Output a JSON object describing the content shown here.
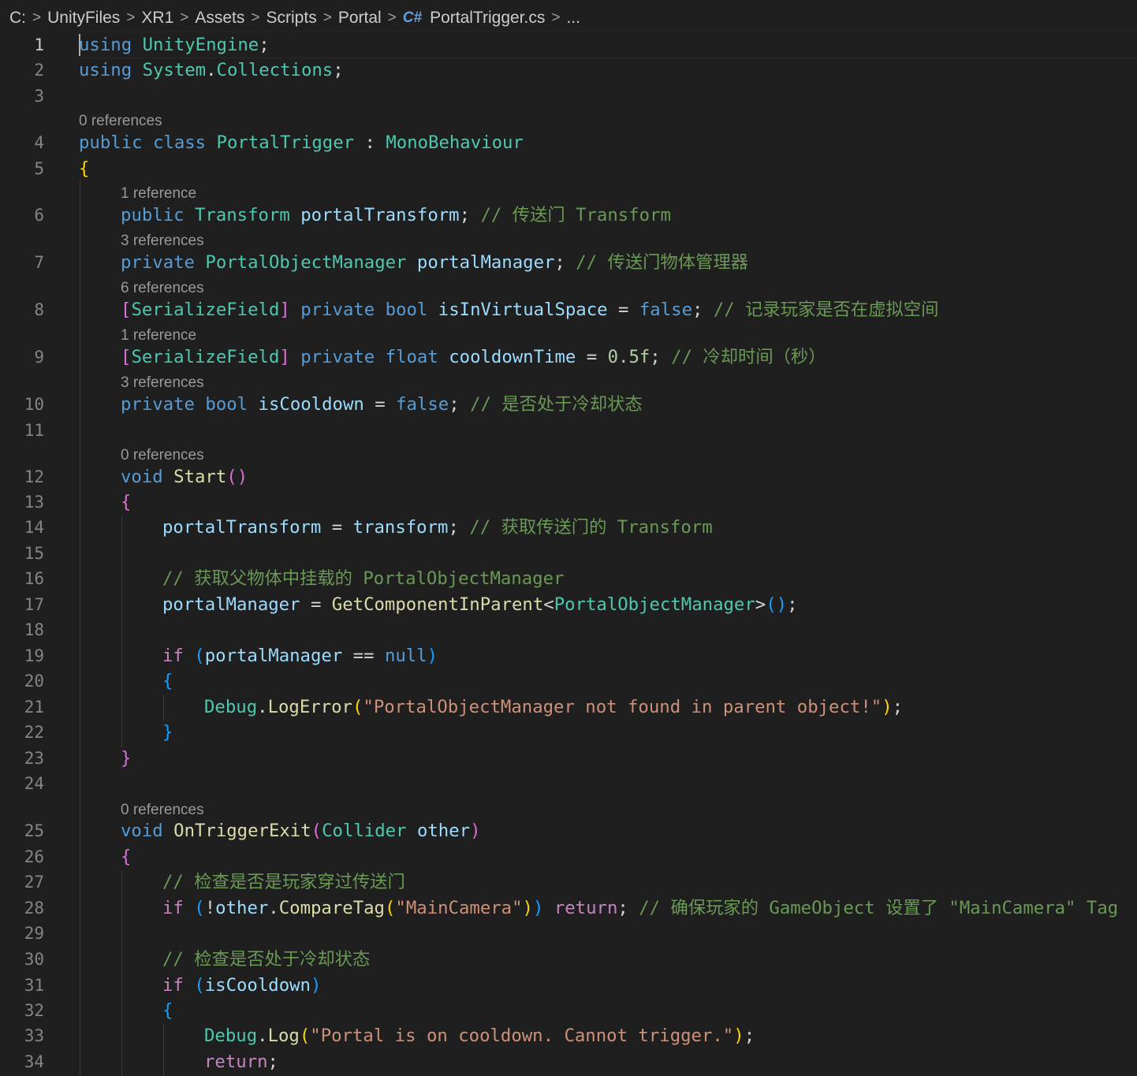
{
  "breadcrumb": [
    "C:",
    "UnityFiles",
    "XR1",
    "Assets",
    "Scripts",
    "Portal",
    "PortalTrigger.cs",
    "..."
  ],
  "cs_icon": "C#",
  "codelens": {
    "l4": "0 references",
    "l6": "1 reference",
    "l7": "3 references",
    "l8": "6 references",
    "l9": "1 reference",
    "l10": "3 references",
    "l12": "0 references",
    "l25": "0 references"
  },
  "lines": [
    {
      "n": "1",
      "tokens": [
        [
          "kw",
          "using"
        ],
        [
          "op",
          " "
        ],
        [
          "typ",
          "UnityEngine"
        ],
        [
          "op",
          ";"
        ]
      ]
    },
    {
      "n": "2",
      "tokens": [
        [
          "kw",
          "using"
        ],
        [
          "op",
          " "
        ],
        [
          "typ",
          "System"
        ],
        [
          "op",
          "."
        ],
        [
          "typ",
          "Collections"
        ],
        [
          "op",
          ";"
        ]
      ]
    },
    {
      "n": "3",
      "tokens": []
    },
    {
      "n": "4",
      "tokens": [
        [
          "kw",
          "public"
        ],
        [
          "op",
          " "
        ],
        [
          "kw",
          "class"
        ],
        [
          "op",
          " "
        ],
        [
          "typ",
          "PortalTrigger"
        ],
        [
          "op",
          " : "
        ],
        [
          "typ",
          "MonoBehaviour"
        ]
      ]
    },
    {
      "n": "5",
      "tokens": [
        [
          "p1",
          "{"
        ]
      ]
    },
    {
      "n": "6",
      "tokens": [
        [
          "kw",
          "public"
        ],
        [
          "op",
          " "
        ],
        [
          "typ",
          "Transform"
        ],
        [
          "op",
          " "
        ],
        [
          "var",
          "portalTransform"
        ],
        [
          "op",
          "; "
        ],
        [
          "cmt",
          "// 传送门 Transform"
        ]
      ]
    },
    {
      "n": "7",
      "tokens": [
        [
          "kw",
          "private"
        ],
        [
          "op",
          " "
        ],
        [
          "typ",
          "PortalObjectManager"
        ],
        [
          "op",
          " "
        ],
        [
          "var",
          "portalManager"
        ],
        [
          "op",
          "; "
        ],
        [
          "cmt",
          "// 传送门物体管理器"
        ]
      ]
    },
    {
      "n": "8",
      "tokens": [
        [
          "p2",
          "["
        ],
        [
          "typ",
          "SerializeField"
        ],
        [
          "p2",
          "]"
        ],
        [
          "op",
          " "
        ],
        [
          "kw",
          "private"
        ],
        [
          "op",
          " "
        ],
        [
          "kw",
          "bool"
        ],
        [
          "op",
          " "
        ],
        [
          "var",
          "isInVirtualSpace"
        ],
        [
          "op",
          " = "
        ],
        [
          "kw",
          "false"
        ],
        [
          "op",
          "; "
        ],
        [
          "cmt",
          "// 记录玩家是否在虚拟空间"
        ]
      ]
    },
    {
      "n": "9",
      "tokens": [
        [
          "p2",
          "["
        ],
        [
          "typ",
          "SerializeField"
        ],
        [
          "p2",
          "]"
        ],
        [
          "op",
          " "
        ],
        [
          "kw",
          "private"
        ],
        [
          "op",
          " "
        ],
        [
          "kw",
          "float"
        ],
        [
          "op",
          " "
        ],
        [
          "var",
          "cooldownTime"
        ],
        [
          "op",
          " = "
        ],
        [
          "num",
          "0.5f"
        ],
        [
          "op",
          "; "
        ],
        [
          "cmt",
          "// 冷却时间（秒）"
        ]
      ]
    },
    {
      "n": "10",
      "tokens": [
        [
          "kw",
          "private"
        ],
        [
          "op",
          " "
        ],
        [
          "kw",
          "bool"
        ],
        [
          "op",
          " "
        ],
        [
          "var",
          "isCooldown"
        ],
        [
          "op",
          " = "
        ],
        [
          "kw",
          "false"
        ],
        [
          "op",
          "; "
        ],
        [
          "cmt",
          "// 是否处于冷却状态"
        ]
      ]
    },
    {
      "n": "11",
      "tokens": []
    },
    {
      "n": "12",
      "tokens": [
        [
          "kw",
          "void"
        ],
        [
          "op",
          " "
        ],
        [
          "fn",
          "Start"
        ],
        [
          "p2",
          "()"
        ]
      ]
    },
    {
      "n": "13",
      "tokens": [
        [
          "p2",
          "{"
        ]
      ]
    },
    {
      "n": "14",
      "tokens": [
        [
          "var",
          "portalTransform"
        ],
        [
          "op",
          " = "
        ],
        [
          "var",
          "transform"
        ],
        [
          "op",
          "; "
        ],
        [
          "cmt",
          "// 获取传送门的 Transform"
        ]
      ]
    },
    {
      "n": "15",
      "tokens": []
    },
    {
      "n": "16",
      "tokens": [
        [
          "cmt",
          "// 获取父物体中挂载的 PortalObjectManager"
        ]
      ]
    },
    {
      "n": "17",
      "tokens": [
        [
          "var",
          "portalManager"
        ],
        [
          "op",
          " = "
        ],
        [
          "fn",
          "GetComponentInParent"
        ],
        [
          "op",
          "<"
        ],
        [
          "typ",
          "PortalObjectManager"
        ],
        [
          "op",
          ">"
        ],
        [
          "p3",
          "()"
        ],
        [
          "op",
          ";"
        ]
      ]
    },
    {
      "n": "18",
      "tokens": []
    },
    {
      "n": "19",
      "tokens": [
        [
          "ctl",
          "if"
        ],
        [
          "op",
          " "
        ],
        [
          "p3",
          "("
        ],
        [
          "var",
          "portalManager"
        ],
        [
          "op",
          " == "
        ],
        [
          "kw",
          "null"
        ],
        [
          "p3",
          ")"
        ]
      ]
    },
    {
      "n": "20",
      "tokens": [
        [
          "p3",
          "{"
        ]
      ]
    },
    {
      "n": "21",
      "tokens": [
        [
          "typ",
          "Debug"
        ],
        [
          "op",
          "."
        ],
        [
          "fn",
          "LogError"
        ],
        [
          "p1",
          "("
        ],
        [
          "str",
          "\"PortalObjectManager not found in parent object!\""
        ],
        [
          "p1",
          ")"
        ],
        [
          "op",
          ";"
        ]
      ]
    },
    {
      "n": "22",
      "tokens": [
        [
          "p3",
          "}"
        ]
      ]
    },
    {
      "n": "23",
      "tokens": [
        [
          "p2",
          "}"
        ]
      ]
    },
    {
      "n": "24",
      "tokens": []
    },
    {
      "n": "25",
      "tokens": [
        [
          "kw",
          "void"
        ],
        [
          "op",
          " "
        ],
        [
          "fn",
          "OnTriggerExit"
        ],
        [
          "p2",
          "("
        ],
        [
          "typ",
          "Collider"
        ],
        [
          "op",
          " "
        ],
        [
          "var",
          "other"
        ],
        [
          "p2",
          ")"
        ]
      ]
    },
    {
      "n": "26",
      "tokens": [
        [
          "p2",
          "{"
        ]
      ]
    },
    {
      "n": "27",
      "tokens": [
        [
          "cmt",
          "// 检查是否是玩家穿过传送门"
        ]
      ]
    },
    {
      "n": "28",
      "tokens": [
        [
          "ctl",
          "if"
        ],
        [
          "op",
          " "
        ],
        [
          "p3",
          "("
        ],
        [
          "op",
          "!"
        ],
        [
          "var",
          "other"
        ],
        [
          "op",
          "."
        ],
        [
          "fn",
          "CompareTag"
        ],
        [
          "p1",
          "("
        ],
        [
          "str",
          "\"MainCamera\""
        ],
        [
          "p1",
          ")"
        ],
        [
          "p3",
          ")"
        ],
        [
          "op",
          " "
        ],
        [
          "ctl",
          "return"
        ],
        [
          "op",
          "; "
        ],
        [
          "cmt",
          "// 确保玩家的 GameObject 设置了 \"MainCamera\" Tag"
        ]
      ]
    },
    {
      "n": "29",
      "tokens": []
    },
    {
      "n": "30",
      "tokens": [
        [
          "cmt",
          "// 检查是否处于冷却状态"
        ]
      ]
    },
    {
      "n": "31",
      "tokens": [
        [
          "ctl",
          "if"
        ],
        [
          "op",
          " "
        ],
        [
          "p3",
          "("
        ],
        [
          "var",
          "isCooldown"
        ],
        [
          "p3",
          ")"
        ]
      ]
    },
    {
      "n": "32",
      "tokens": [
        [
          "p3",
          "{"
        ]
      ]
    },
    {
      "n": "33",
      "tokens": [
        [
          "typ",
          "Debug"
        ],
        [
          "op",
          "."
        ],
        [
          "fn",
          "Log"
        ],
        [
          "p1",
          "("
        ],
        [
          "str",
          "\"Portal is on cooldown. Cannot trigger.\""
        ],
        [
          "p1",
          ")"
        ],
        [
          "op",
          ";"
        ]
      ]
    },
    {
      "n": "34",
      "tokens": [
        [
          "ctl",
          "return"
        ],
        [
          "op",
          ";"
        ]
      ]
    }
  ]
}
